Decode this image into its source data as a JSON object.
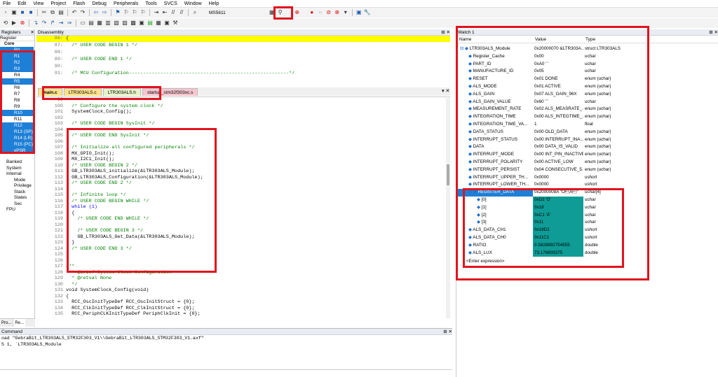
{
  "menu": [
    "File",
    "Edit",
    "View",
    "Project",
    "Flash",
    "Debug",
    "Peripherals",
    "Tools",
    "SVCS",
    "Window",
    "Help"
  ],
  "toolbar": {
    "target": "MS5611"
  },
  "registers": {
    "title": "Registers",
    "col": "Register",
    "group": "Core",
    "items": [
      "R0",
      "R1",
      "R2",
      "R3",
      "R4",
      "R5",
      "R6",
      "R7",
      "R8",
      "R9",
      "R10",
      "R11",
      "R12",
      "R13 (SP)",
      "R14 (LR)",
      "R15 (PC)",
      "xPSR"
    ],
    "selected": [
      0,
      1,
      2,
      3,
      5,
      10,
      12,
      13,
      14,
      15,
      16
    ],
    "other": [
      "Banked",
      "System",
      "Internal",
      "Mode",
      "Privilege",
      "Stack",
      "States",
      "Sec",
      "FPU"
    ],
    "tab_a": "Pro...",
    "tab_b": "Re..."
  },
  "disassembly": {
    "title": "Disassembly",
    "lines": [
      {
        "n": "86:",
        "t": "{",
        "hl": true
      },
      {
        "n": "87:",
        "t": "  /* USER CODE BEGIN 1 */"
      },
      {
        "n": "88:",
        "t": ""
      },
      {
        "n": "89:",
        "t": "  /* USER CODE END 1 */"
      },
      {
        "n": "90:",
        "t": ""
      },
      {
        "n": "91:",
        "t": "  /* MCU Configuration--------------------------------------------------------*/"
      }
    ]
  },
  "editor_tabs": [
    "main.c",
    "LTR303ALS.c",
    "LTR303ALS.h",
    "startup_stm32f303xc.s"
  ],
  "code": [
    {
      "n": "99",
      "t": ""
    },
    {
      "n": "100",
      "t": "  /* Configure the system clock */",
      "c": 1
    },
    {
      "n": "101",
      "t": "  SystemClock_Config();"
    },
    {
      "n": "102",
      "t": ""
    },
    {
      "n": "103",
      "t": "  /* USER CODE BEGIN SysInit */",
      "c": 1
    },
    {
      "n": "104",
      "t": ""
    },
    {
      "n": "105",
      "t": "  /* USER CODE END SysInit */",
      "c": 1
    },
    {
      "n": "106",
      "t": ""
    },
    {
      "n": "107",
      "t": "  /* Initialize all configured peripherals */",
      "c": 1
    },
    {
      "n": "108",
      "t": "  MX_GPIO_Init();"
    },
    {
      "n": "109",
      "t": "  MX_I2C1_Init();"
    },
    {
      "n": "110",
      "t": "  /* USER CODE BEGIN 2 */",
      "c": 1
    },
    {
      "n": "111",
      "t": "  GB_LTR303ALS_initialize(&LTR303ALS_Module);"
    },
    {
      "n": "112",
      "t": "  GB_LTR303ALS_Configuration(&LTR303ALS_Module);"
    },
    {
      "n": "113",
      "t": "  /* USER CODE END 2 */",
      "c": 1
    },
    {
      "n": "114",
      "t": ""
    },
    {
      "n": "115",
      "t": "  /* Infinite loop */",
      "c": 1
    },
    {
      "n": "116",
      "t": "  /* USER CODE BEGIN WHILE */",
      "c": 1
    },
    {
      "n": "117",
      "t": "  while (1)",
      "k": 1
    },
    {
      "n": "118",
      "t": "  {"
    },
    {
      "n": "119",
      "t": "    /* USER CODE END WHILE */",
      "c": 1
    },
    {
      "n": "120",
      "t": ""
    },
    {
      "n": "121",
      "t": "    /* USER CODE BEGIN 3 */",
      "c": 1
    },
    {
      "n": "122",
      "t": "    GB_LTR303ALS_Get_Data(&LTR303ALS_Module);"
    },
    {
      "n": "123",
      "t": "  }"
    },
    {
      "n": "124",
      "t": "  /* USER CODE END 3 */",
      "c": 1
    },
    {
      "n": "125",
      "t": "}"
    },
    {
      "n": "126",
      "t": ""
    },
    {
      "n": "127",
      "t": "/**",
      "c": 1
    },
    {
      "n": "128",
      "t": "  * @brief System Clock Configuration",
      "c": 1
    },
    {
      "n": "129",
      "t": "  * @retval None",
      "c": 1
    },
    {
      "n": "130",
      "t": "  */",
      "c": 1
    },
    {
      "n": "131",
      "t": "void SystemClock_Config(void)"
    },
    {
      "n": "132",
      "t": "{"
    },
    {
      "n": "133",
      "t": "  RCC_OscInitTypeDef RCC_OscInitStruct = {0};"
    },
    {
      "n": "134",
      "t": "  RCC_ClkInitTypeDef RCC_ClkInitStruct = {0};"
    },
    {
      "n": "135",
      "t": "  RCC_PeriphCLKInitTypeDef PeriphClkInit = {0};"
    }
  ],
  "command": {
    "title": "Command",
    "lines": [
      "oad \"GebraBit_LTR303ALS_STM32F303_V1\\\\GebraBit_LTR303ALS_STM32F303_V1.axf\"",
      "S 1, `LTR303ALS_Module"
    ]
  },
  "watch": {
    "title": "Watch 1",
    "cols": [
      "Name",
      "Value",
      "Type"
    ],
    "rows": [
      {
        "n": "LTR303ALS_Module",
        "v": "0x20000070 &LTR303A...",
        "t": "struct LTR303ALS",
        "lvl": 0
      },
      {
        "n": "Register_Cache",
        "v": "0x00",
        "t": "uchar",
        "lvl": 1
      },
      {
        "n": "PART_ID",
        "v": "0xA0 ' '",
        "t": "uchar",
        "lvl": 1
      },
      {
        "n": "MANUFACTURE_ID",
        "v": "0x05",
        "t": "uchar",
        "lvl": 1
      },
      {
        "n": "RESET",
        "v": "0x01 DONE",
        "t": "enum (uchar)",
        "lvl": 1
      },
      {
        "n": "ALS_MODE",
        "v": "0x01 ACTIVE",
        "t": "enum (uchar)",
        "lvl": 1
      },
      {
        "n": "ALS_GAIN",
        "v": "0x07 ALS_GAIN_96X",
        "t": "enum (uchar)",
        "lvl": 1
      },
      {
        "n": "ALS_GAIN_VALUE",
        "v": "0x60 '`'",
        "t": "uchar",
        "lvl": 1
      },
      {
        "n": "MEASUREMENT_RATE",
        "v": "0x02 ALS_MEASRATE_...",
        "t": "enum (uchar)",
        "lvl": 1
      },
      {
        "n": "INTEGRATION_TIME",
        "v": "0x00 ALS_INTEGTIME_...",
        "t": "enum (uchar)",
        "lvl": 1
      },
      {
        "n": "INTEGRATION_TIME_VA...",
        "v": "1",
        "t": "float",
        "lvl": 1
      },
      {
        "n": "DATA_STATUS",
        "v": "0x00 OLD_DATA",
        "t": "enum (uchar)",
        "lvl": 1
      },
      {
        "n": "INTERRUPT_STATUS",
        "v": "0x00 INTERRUPT_INA...",
        "t": "enum (uchar)",
        "lvl": 1
      },
      {
        "n": "DATA",
        "v": "0x00 DATA_IS_VALID",
        "t": "enum (uchar)",
        "lvl": 1
      },
      {
        "n": "INTERRUPT_MODE",
        "v": "0x00 INT_PIN_INACTIVE",
        "t": "enum (uchar)",
        "lvl": 1
      },
      {
        "n": "INTERRUPT_POLARITY",
        "v": "0x00 ACTIVE_LOW",
        "t": "enum (uchar)",
        "lvl": 1
      },
      {
        "n": "INTERRUPT_PERSIST",
        "v": "0x04 CONSECUTIVE_5...",
        "t": "enum (uchar)",
        "lvl": 1
      },
      {
        "n": "INTERRUPT_UPPER_TH...",
        "v": "0x0000",
        "t": "ushort",
        "lvl": 1
      },
      {
        "n": "INTERRUPT_LOWER_TH...",
        "v": "0x0000",
        "t": "ushort",
        "lvl": 1
      },
      {
        "n": "REGISTER_DATA",
        "v": "0x2000008A \"Ò\u0011Á\u0011\"",
        "t": "uchar[4]",
        "lvl": 1,
        "sel": 1
      },
      {
        "n": "[0]",
        "v": "0xD2 'Ò'",
        "t": "uchar",
        "lvl": 2,
        "tl": 1
      },
      {
        "n": "[1]",
        "v": "0x18",
        "t": "uchar",
        "lvl": 2,
        "tl": 1
      },
      {
        "n": "[2]",
        "v": "0xC1 'Á'",
        "t": "uchar",
        "lvl": 2,
        "tl": 1
      },
      {
        "n": "[3]",
        "v": "0x11",
        "t": "uchar",
        "lvl": 2,
        "tl": 1
      },
      {
        "n": "ALS_DATA_CH1",
        "v": "0x18D2",
        "t": "ushort",
        "lvl": 1,
        "tl": 1
      },
      {
        "n": "ALS_DATA_CH0",
        "v": "0x11C1",
        "t": "ushort",
        "lvl": 1,
        "tl": 1
      },
      {
        "n": "RATIO",
        "v": "0.5828892754555",
        "t": "double",
        "lvl": 1,
        "tl": 1
      },
      {
        "n": "ALS_LUX",
        "v": "73.176809375",
        "t": "double",
        "lvl": 1,
        "tl": 1
      }
    ],
    "enter": "<Enter expression>"
  }
}
